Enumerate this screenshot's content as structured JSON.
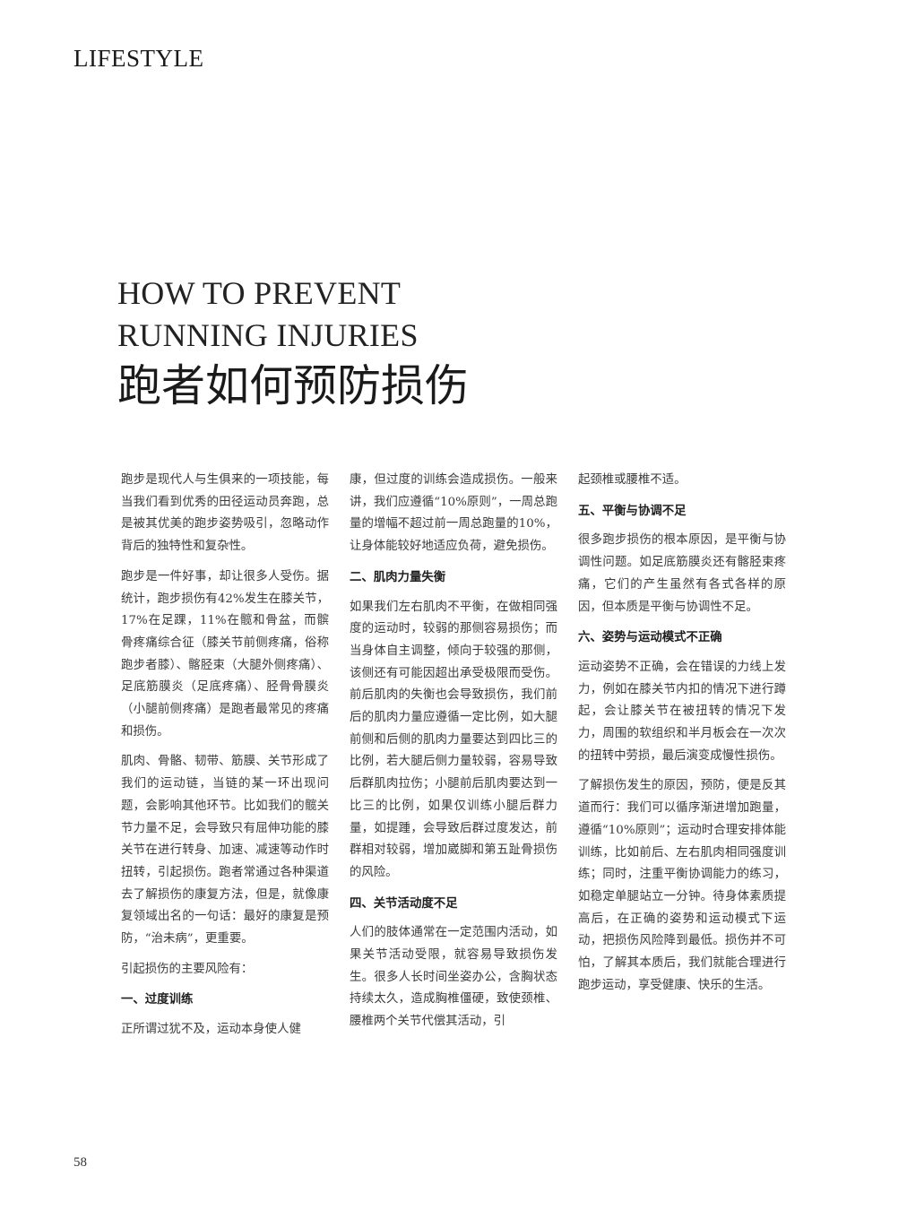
{
  "header": {
    "section": "LIFESTYLE"
  },
  "title": {
    "en_line1": "HOW TO PREVENT",
    "en_line2": "RUNNING INJURIES",
    "cn": "跑者如何预防损伤"
  },
  "columns": {
    "col1": {
      "p1": "跑步是现代人与生俱来的一项技能，每当我们看到优秀的田径运动员奔跑，总是被其优美的跑步姿势吸引，忽略动作背后的独特性和复杂性。",
      "p2": "跑步是一件好事，却让很多人受伤。据统计，跑步损伤有42%发生在膝关节，17%在足踝，11%在髋和骨盆，而髌骨疼痛综合征（膝关节前侧疼痛，俗称跑步者膝）、髂胫束（大腿外侧疼痛）、足底筋膜炎（足底疼痛）、胫骨骨膜炎（小腿前侧疼痛）是跑者最常见的疼痛和损伤。",
      "p3": "肌肉、骨骼、韧带、筋膜、关节形成了我们的运动链，当链的某一环出现问题，会影响其他环节。比如我们的髋关节力量不足，会导致只有屈伸功能的膝关节在进行转身、加速、减速等动作时扭转，引起损伤。跑者常通过各种渠道去了解损伤的康复方法，但是，就像康复领域出名的一句话：最好的康复是预防，“治未病”，更重要。",
      "p4": "引起损伤的主要风险有：",
      "h1": "一、过度训练",
      "p5": "正所谓过犹不及，运动本身使人健"
    },
    "col2": {
      "p1": "康，但过度的训练会造成损伤。一般来讲，我们应遵循“10%原则”，一周总跑量的增幅不超过前一周总跑量的10%，让身体能较好地适应负荷，避免损伤。",
      "h2": "二、肌肉力量失衡",
      "p2": "如果我们左右肌肉不平衡，在做相同强度的运动时，较弱的那侧容易损伤；而当身体自主调整，倾向于较强的那侧，该侧还有可能因超出承受极限而受伤。前后肌肉的失衡也会导致损伤，我们前后的肌肉力量应遵循一定比例，如大腿前侧和后侧的肌肉力量要达到四比三的比例，若大腿后侧力量较弱，容易导致后群肌肉拉伤；小腿前后肌肉要达到一比三的比例，如果仅训练小腿后群力量，如提踵，会导致后群过度发达，前群相对较弱，增加崴脚和第五趾骨损伤的风险。",
      "h4": "四、关节活动度不足",
      "p3": "人们的肢体通常在一定范围内活动，如果关节活动受限，就容易导致损伤发生。很多人长时间坐姿办公，含胸状态持续太久，造成胸椎僵硬，致使颈椎、腰椎两个关节代偿其活动，引"
    },
    "col3": {
      "p1": "起颈椎或腰椎不适。",
      "h5": "五、平衡与协调不足",
      "p2": "很多跑步损伤的根本原因，是平衡与协调性问题。如足底筋膜炎还有髂胫束疼痛，它们的产生虽然有各式各样的原因，但本质是平衡与协调性不足。",
      "h6": "六、姿势与运动模式不正确",
      "p3": "运动姿势不正确，会在错误的力线上发力，例如在膝关节内扣的情况下进行蹲起，会让膝关节在被扭转的情况下发力，周围的软组织和半月板会在一次次的扭转中劳损，最后演变成慢性损伤。",
      "p4": "了解损伤发生的原因，预防，便是反其道而行：我们可以循序渐进增加跑量，遵循“10%原则”；运动时合理安排体能训练，比如前后、左右肌肉相同强度训练；同时，注重平衡协调能力的练习，如稳定单腿站立一分钟。待身体素质提高后，在正确的姿势和运动模式下运动，把损伤风险降到最低。损伤并不可怕，了解其本质后，我们就能合理进行跑步运动，享受健康、快乐的生活。"
    }
  },
  "footer": {
    "page_number": "58"
  }
}
